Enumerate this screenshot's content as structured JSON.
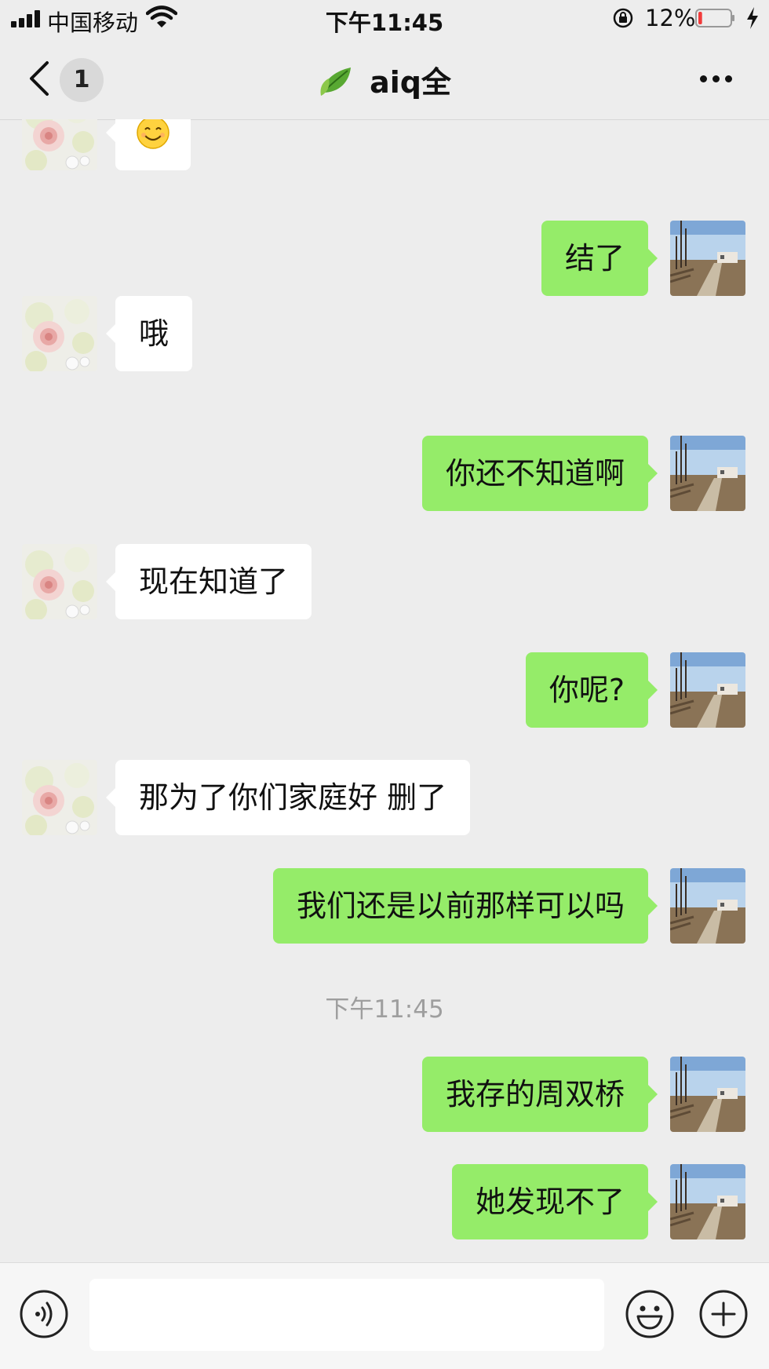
{
  "status_bar": {
    "carrier": "中国移动",
    "time": "下午11:45",
    "battery_percent": "12%",
    "battery_level": 0.12,
    "icons": [
      "signal-icon",
      "wifi-icon",
      "rotation-lock-icon",
      "battery-icon",
      "charging-icon"
    ]
  },
  "nav": {
    "back_icon": "chevron-left-icon",
    "unread_count": "1",
    "title": "aiq全",
    "title_icon": "leaf-icon",
    "more_icon": "more-dots-icon"
  },
  "messages": [
    {
      "side": "in",
      "type": "emoji",
      "text": "😊"
    },
    {
      "side": "out",
      "type": "text",
      "text": "结了"
    },
    {
      "side": "in",
      "type": "text",
      "text": "哦"
    },
    {
      "side": "out",
      "type": "text",
      "text": "你还不知道啊"
    },
    {
      "side": "in",
      "type": "text",
      "text": "现在知道了"
    },
    {
      "side": "out",
      "type": "text",
      "text": "你呢?"
    },
    {
      "side": "in",
      "type": "text",
      "text": "那为了你们家庭好 删了"
    },
    {
      "side": "out",
      "type": "text",
      "text": "我们还是以前那样可以吗"
    },
    {
      "side": "center",
      "type": "time",
      "text": "下午11:45"
    },
    {
      "side": "out",
      "type": "text",
      "text": "我存的周双桥"
    },
    {
      "side": "out",
      "type": "text",
      "text": "她发现不了"
    }
  ],
  "input_bar": {
    "voice_icon": "voice-icon",
    "text_value": "",
    "emoji_icon": "emoji-icon",
    "plus_icon": "plus-icon"
  },
  "colors": {
    "background": "#ededed",
    "outgoing_bubble": "#95ec69",
    "incoming_bubble": "#ffffff",
    "battery_low": "#f23b3b"
  }
}
